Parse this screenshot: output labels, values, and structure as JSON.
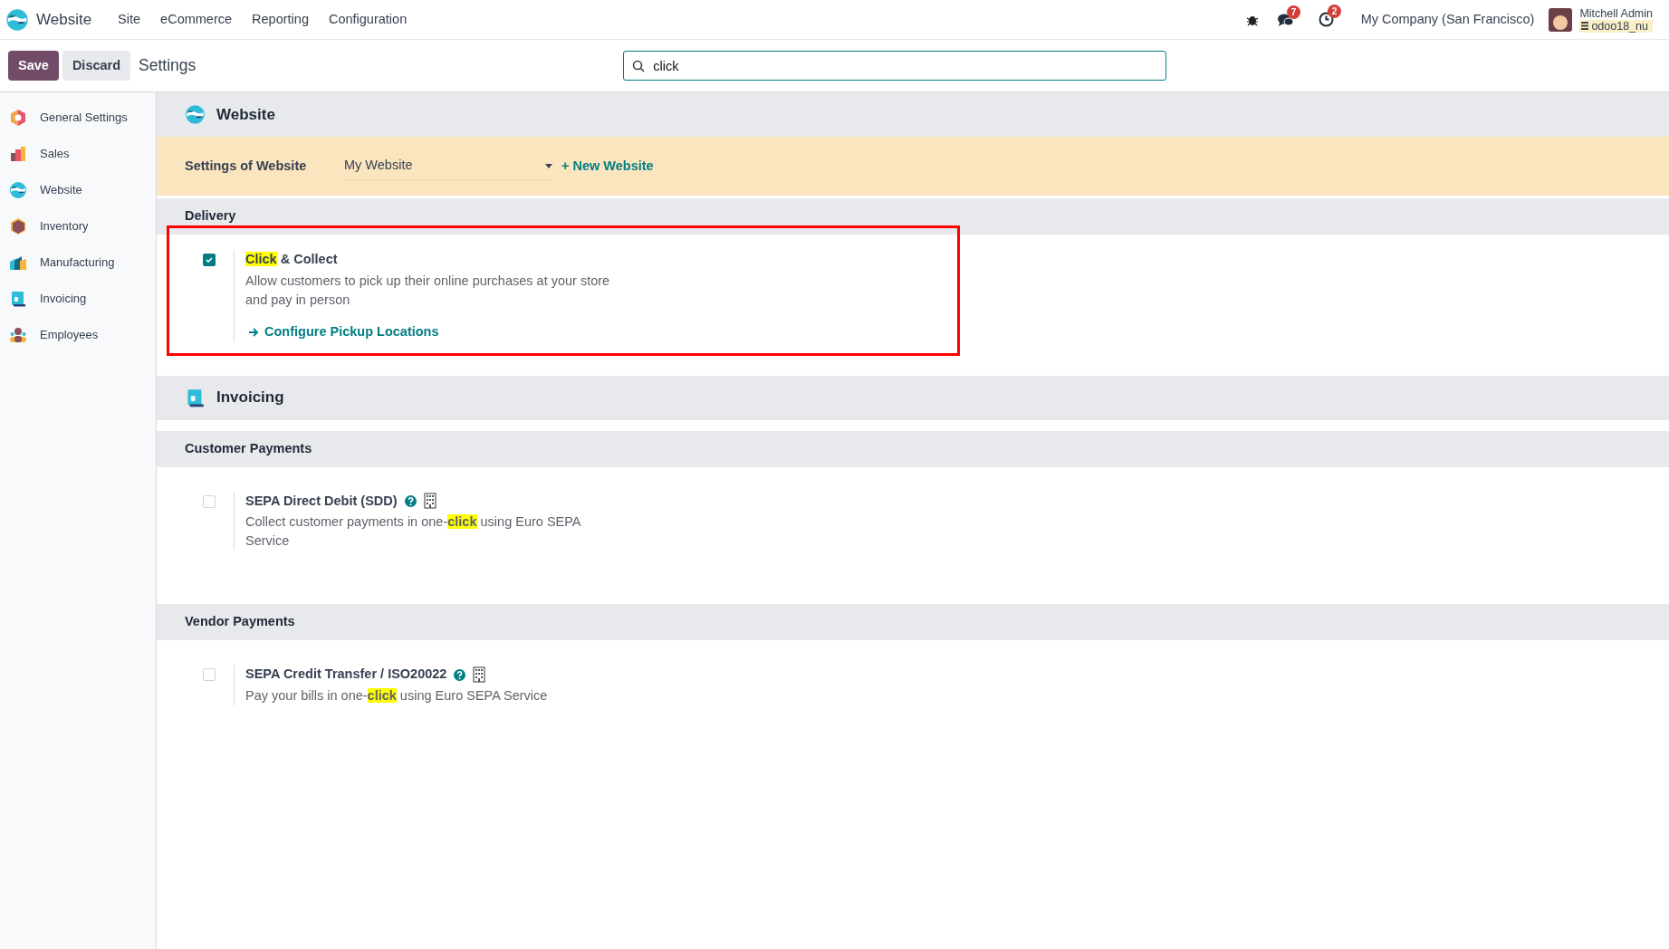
{
  "navbar": {
    "app_name": "Website",
    "menus": [
      "Site",
      "eCommerce",
      "Reporting",
      "Configuration"
    ],
    "messages_badge": "7",
    "activities_badge": "2",
    "company": "My Company (San Francisco)",
    "user_name": "Mitchell Admin",
    "database": "odoo18_nu"
  },
  "control_panel": {
    "buttons": [
      "Save",
      "Discard"
    ],
    "title": "Settings",
    "search": {
      "value": "click"
    }
  },
  "sidebar": {
    "items": [
      {
        "label": "General Settings",
        "kind": "general",
        "selected": false
      },
      {
        "label": "Sales",
        "kind": "sales",
        "selected": false
      },
      {
        "label": "Website",
        "kind": "website",
        "selected": false
      },
      {
        "label": "Inventory",
        "kind": "inventory",
        "selected": false
      },
      {
        "label": "Manufacturing",
        "kind": "manufacturing",
        "selected": false
      },
      {
        "label": "Invoicing",
        "kind": "invoicing",
        "selected": false
      },
      {
        "label": "Employees",
        "kind": "employees",
        "selected": false
      }
    ]
  },
  "apps": [
    {
      "title": "Website",
      "kind": "website",
      "website_bar": {
        "label": "Settings of Website",
        "value": "My Website",
        "new_button": "+ New Website"
      },
      "sections": [
        {
          "title": "Delivery",
          "settings": [
            {
              "title": [
                {
                  "text": "Click",
                  "highlighted": true
                },
                {
                  "text": " & Collect",
                  "highlighted": false
                }
              ],
              "description": [
                {
                  "text": "Allow customers to pick up their online purchases at your store and pay in person",
                  "highlighted": false
                }
              ],
              "checked": true,
              "help": false,
              "company_specific": false,
              "link": "Configure Pickup Locations",
              "outlined": true
            }
          ]
        }
      ]
    },
    {
      "title": "Invoicing",
      "kind": "invoicing",
      "sections": [
        {
          "title": "Customer Payments",
          "settings": [
            {
              "title": [
                {
                  "text": "SEPA Direct Debit (SDD)",
                  "highlighted": false
                }
              ],
              "description": [
                {
                  "text": "Collect customer payments in one-",
                  "highlighted": false
                },
                {
                  "text": "click",
                  "highlighted": true
                },
                {
                  "text": " using Euro SEPA Service",
                  "highlighted": false
                }
              ],
              "checked": false,
              "help": true,
              "company_specific": true,
              "outlined": false
            }
          ]
        },
        {
          "title": "Vendor Payments",
          "settings": [
            {
              "title": [
                {
                  "text": "SEPA Credit Transfer / ISO20022",
                  "highlighted": false
                }
              ],
              "description": [
                {
                  "text": "Pay your bills in one-",
                  "highlighted": false
                },
                {
                  "text": "click",
                  "highlighted": true
                },
                {
                  "text": " using Euro SEPA Service",
                  "highlighted": false
                }
              ],
              "checked": false,
              "help": true,
              "company_specific": true,
              "outlined": false
            }
          ]
        }
      ]
    }
  ]
}
